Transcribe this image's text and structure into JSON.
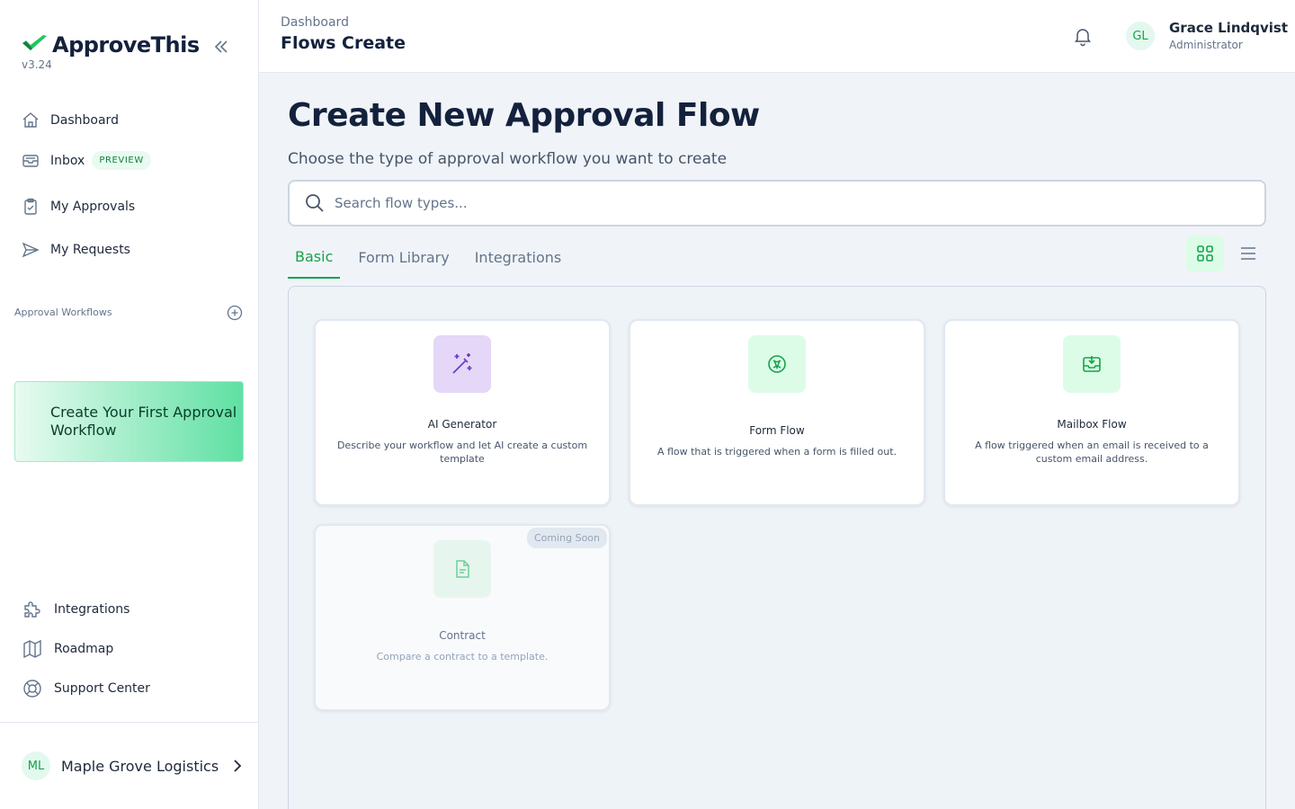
{
  "brand": {
    "name": "ApproveThis",
    "version": "v3.24"
  },
  "nav": {
    "dashboard": "Dashboard",
    "inbox": "Inbox",
    "inbox_badge": "PREVIEW",
    "my_approvals": "My Approvals",
    "my_requests": "My Requests"
  },
  "workflows": {
    "section_label": "Approval Workflows",
    "cta_icon": "",
    "cta_label": "Create Your First Approval Workflow"
  },
  "bottom_nav": {
    "integrations": "Integrations",
    "roadmap": "Roadmap",
    "support": "Support Center"
  },
  "org": {
    "initials": "ML",
    "name": "Maple Grove Logistics"
  },
  "header": {
    "breadcrumb": "Dashboard",
    "title": "Flows Create",
    "user_initials": "GL",
    "user_name": "Grace Lindqvist",
    "user_role": "Administrator"
  },
  "main": {
    "title": "Create New Approval Flow",
    "subtitle": "Choose the type of approval workflow you want to create",
    "search_placeholder": "Search flow types...",
    "tabs": [
      "Basic",
      "Form Library",
      "Integrations"
    ],
    "active_tab": "Basic"
  },
  "cards": [
    {
      "title": "AI Generator",
      "description": "Describe your workflow and let AI create a custom template",
      "icon": "magic-wand-icon"
    },
    {
      "title": "Form Flow",
      "description": "A flow that is triggered when a form is filled out.",
      "icon": "form-icon"
    },
    {
      "title": "Mailbox Flow",
      "description": "A flow triggered when an email is received to a custom email address.",
      "icon": "inbox-download-icon"
    },
    {
      "title": "Contract",
      "description": "Compare a contract to a template.",
      "icon": "document-icon",
      "badge": "Coming Soon"
    }
  ],
  "colors": {
    "accent": "#16a34a",
    "ai_icon_bg": "#e4d7f7",
    "brand_dark": "#14213d"
  }
}
